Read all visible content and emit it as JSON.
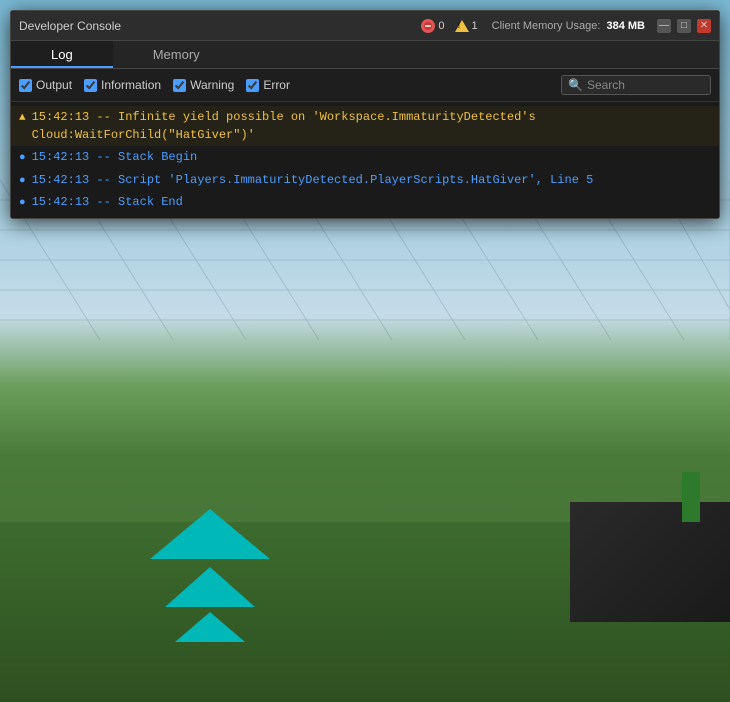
{
  "titlebar": {
    "title": "Developer Console",
    "dot_count": "0",
    "warn_count": "1",
    "memory_label": "Client Memory Usage:",
    "memory_value": "384 MB",
    "minimize_label": "—",
    "maximize_label": "□",
    "close_label": "✕"
  },
  "tabs": [
    {
      "id": "log",
      "label": "Log",
      "active": true
    },
    {
      "id": "memory",
      "label": "Memory",
      "active": false
    }
  ],
  "filterbar": {
    "output_label": "Output",
    "information_label": "Information",
    "warning_label": "Warning",
    "error_label": "Error",
    "search_placeholder": "Search"
  },
  "log_entries": [
    {
      "type": "warning",
      "icon": "▲",
      "text": "15:42:13 -- Infinite yield possible on 'Workspace.ImmaturityDetected's Cloud:WaitForChild(\"HatGiver\")'",
      "icon_class": "warn",
      "text_class": "warn"
    },
    {
      "type": "info",
      "icon": "●",
      "text": "15:42:13 -- Stack Begin",
      "icon_class": "info",
      "text_class": "info"
    },
    {
      "type": "info",
      "icon": "●",
      "text": "15:42:13 -- Script 'Players.ImmaturityDetected.PlayerScripts.HatGiver', Line 5",
      "icon_class": "info",
      "text_class": "script"
    },
    {
      "type": "info",
      "icon": "●",
      "text": "15:42:13 -- Stack End",
      "icon_class": "info",
      "text_class": "info"
    }
  ],
  "colors": {
    "accent_blue": "#4a9eff",
    "warn_yellow": "#f0c040",
    "console_bg": "#1e1e1e",
    "titlebar_bg": "#2d2d2d"
  }
}
